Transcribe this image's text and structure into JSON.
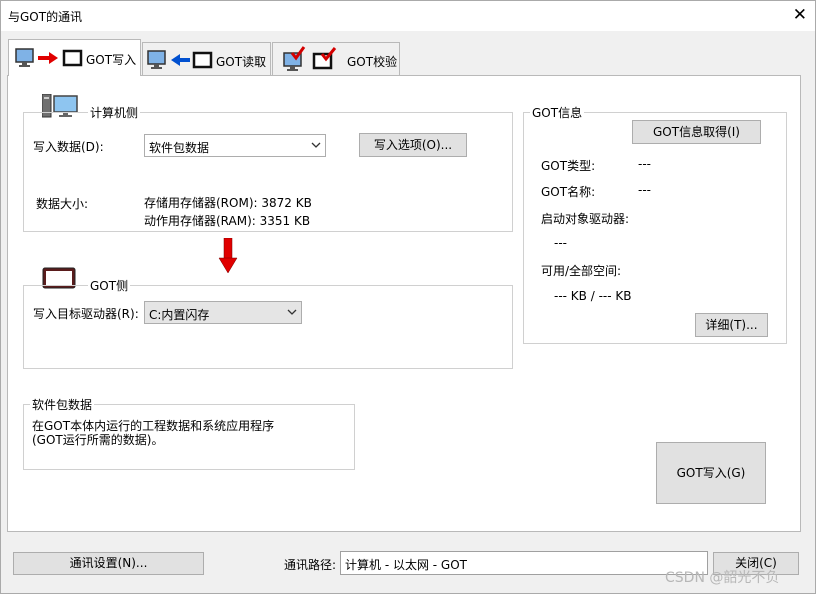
{
  "window": {
    "title": "与GOT的通讯",
    "close_glyph": "✕"
  },
  "tabs": [
    {
      "label": "GOT写入",
      "icon": "pc-to-got-write-icon",
      "active": true
    },
    {
      "label": "GOT读取",
      "icon": "got-to-pc-read-icon",
      "active": false
    },
    {
      "label": "GOT校验",
      "icon": "verify-icon",
      "active": false
    }
  ],
  "computer_side": {
    "legend": "计算机侧",
    "write_data_label": "写入数据(D):",
    "write_data_value": "软件包数据",
    "write_option_button": "写入选项(O)...",
    "data_size_label": "数据大小:",
    "rom_line": "存储用存储器(ROM): 3872 KB",
    "ram_line": "动作用存储器(RAM): 3351 KB"
  },
  "got_side": {
    "legend": "GOT侧",
    "target_drive_label": "写入目标驱动器(R):",
    "target_drive_value": "C:内置闪存"
  },
  "package_data": {
    "legend": "软件包数据",
    "line1": "在GOT本体内运行的工程数据和系统应用程序",
    "line2": "(GOT运行所需的数据)。"
  },
  "got_info": {
    "legend": "GOT信息",
    "get_button": "GOT信息取得(I)",
    "type_label": "GOT类型:",
    "type_value": "---",
    "name_label": "GOT名称:",
    "name_value": "---",
    "boot_drive_label": "启动对象驱动器:",
    "boot_drive_value": "---",
    "space_label": "可用/全部空间:",
    "space_value": "--- KB / --- KB",
    "detail_button": "详细(T)..."
  },
  "write_button": "GOT写入(G)",
  "footer": {
    "comm_settings_button": "通讯设置(N)...",
    "path_label": "通讯路径:",
    "path_value": "计算机 - 以太网 - GOT",
    "close_button": "关闭(C)"
  },
  "watermark": "CSDN @韶光不负",
  "colors": {
    "arrow_red": "#e00000",
    "arrow_blue": "#0050d0",
    "check_red": "#d40000"
  }
}
